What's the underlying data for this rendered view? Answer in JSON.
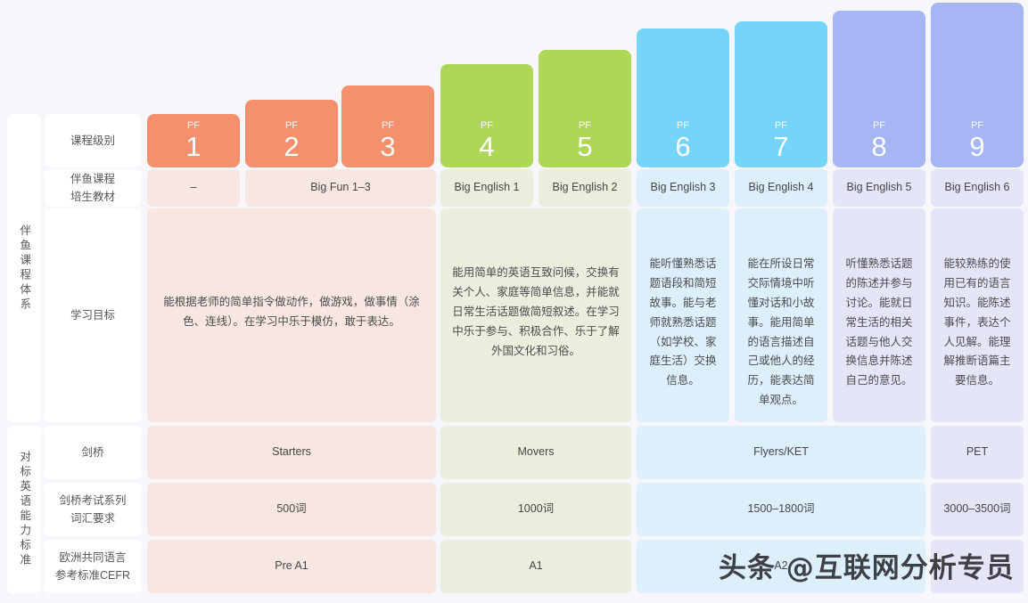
{
  "groups": [
    {
      "id": "course-system",
      "label": "伴鱼课程体系"
    },
    {
      "id": "english-standard",
      "label": "对标英语能力标准"
    }
  ],
  "row_labels": {
    "level": "课程级别",
    "textbook": "伴鱼课程\n培生教材",
    "goal": "学习目标",
    "cambridge": "剑桥",
    "vocabulary": "剑桥考试系列\n词汇要求",
    "cefr": "欧洲共同语言\n参考标准CEFR"
  },
  "colors": {
    "orange": "#f4906c",
    "green": "#aed757",
    "blue": "#74d5f9",
    "purple": "#a6b6f5",
    "orange_tint": "#f8e7e0",
    "green_tint": "#e9efdc",
    "blue_tint": "#ddeffb",
    "purple_tint": "#e4e6f8",
    "page_background": "#f7f7fb"
  },
  "levels": [
    {
      "prefix": "PF",
      "number": "1",
      "color": "orange"
    },
    {
      "prefix": "PF",
      "number": "2",
      "color": "orange"
    },
    {
      "prefix": "PF",
      "number": "3",
      "color": "orange"
    },
    {
      "prefix": "PF",
      "number": "4",
      "color": "green"
    },
    {
      "prefix": "PF",
      "number": "5",
      "color": "green"
    },
    {
      "prefix": "PF",
      "number": "6",
      "color": "blue"
    },
    {
      "prefix": "PF",
      "number": "7",
      "color": "blue"
    },
    {
      "prefix": "PF",
      "number": "8",
      "color": "purple"
    },
    {
      "prefix": "PF",
      "number": "9",
      "color": "purple"
    }
  ],
  "textbooks": [
    {
      "value": "–",
      "span": 1
    },
    {
      "value": "Big Fun 1–3",
      "span": 2
    },
    {
      "value": "Big English 1",
      "span": 1
    },
    {
      "value": "Big English 2",
      "span": 1
    },
    {
      "value": "Big English 3",
      "span": 1
    },
    {
      "value": "Big English 4",
      "span": 1
    },
    {
      "value": "Big English 5",
      "span": 1
    },
    {
      "value": "Big English 6",
      "span": 1
    }
  ],
  "goals": [
    {
      "value": "能根据老师的简单指令做动作，做游戏，做事情（涂色、连线）。在学习中乐于模仿，敢于表达。",
      "span": 3
    },
    {
      "value": "能用简单的英语互致问候，交换有关个人、家庭等简单信息，并能就日常生活话题做简短叙述。在学习中乐于参与、积极合作、乐于了解外国文化和习俗。",
      "span": 2
    },
    {
      "value": "能听懂熟悉话题语段和简短故事。能与老师就熟悉话题（如学校、家庭生活）交换信息。",
      "span": 1
    },
    {
      "value": "能在所设日常交际情境中听懂对话和小故事。能用简单的语言描述自己或他人的经历，能表达简单观点。",
      "span": 1
    },
    {
      "value": "听懂熟悉话题的陈述并参与讨论。能就日常生活的相关话题与他人交换信息并陈述自己的意见。",
      "span": 1
    },
    {
      "value": "能较熟练的使用已有的语言知识。能陈述事件，表达个人见解。能理解推断语篇主要信息。",
      "span": 1
    }
  ],
  "cambridge": [
    {
      "value": "Starters",
      "span": 3
    },
    {
      "value": "Movers",
      "span": 2
    },
    {
      "value": "Flyers/KET",
      "span": 3
    },
    {
      "value": "PET",
      "span": 1
    }
  ],
  "vocabulary": [
    {
      "value": "500词",
      "span": 3
    },
    {
      "value": "1000词",
      "span": 2
    },
    {
      "value": "1500–1800词",
      "span": 3
    },
    {
      "value": "3000–3500词",
      "span": 1
    }
  ],
  "cefr": [
    {
      "value": "Pre A1",
      "span": 3
    },
    {
      "value": "A1",
      "span": 2
    },
    {
      "value": "A2",
      "span": 3
    },
    {
      "value": "",
      "span": 1
    }
  ],
  "watermark": {
    "text": "头条 @互联网分析专员"
  }
}
